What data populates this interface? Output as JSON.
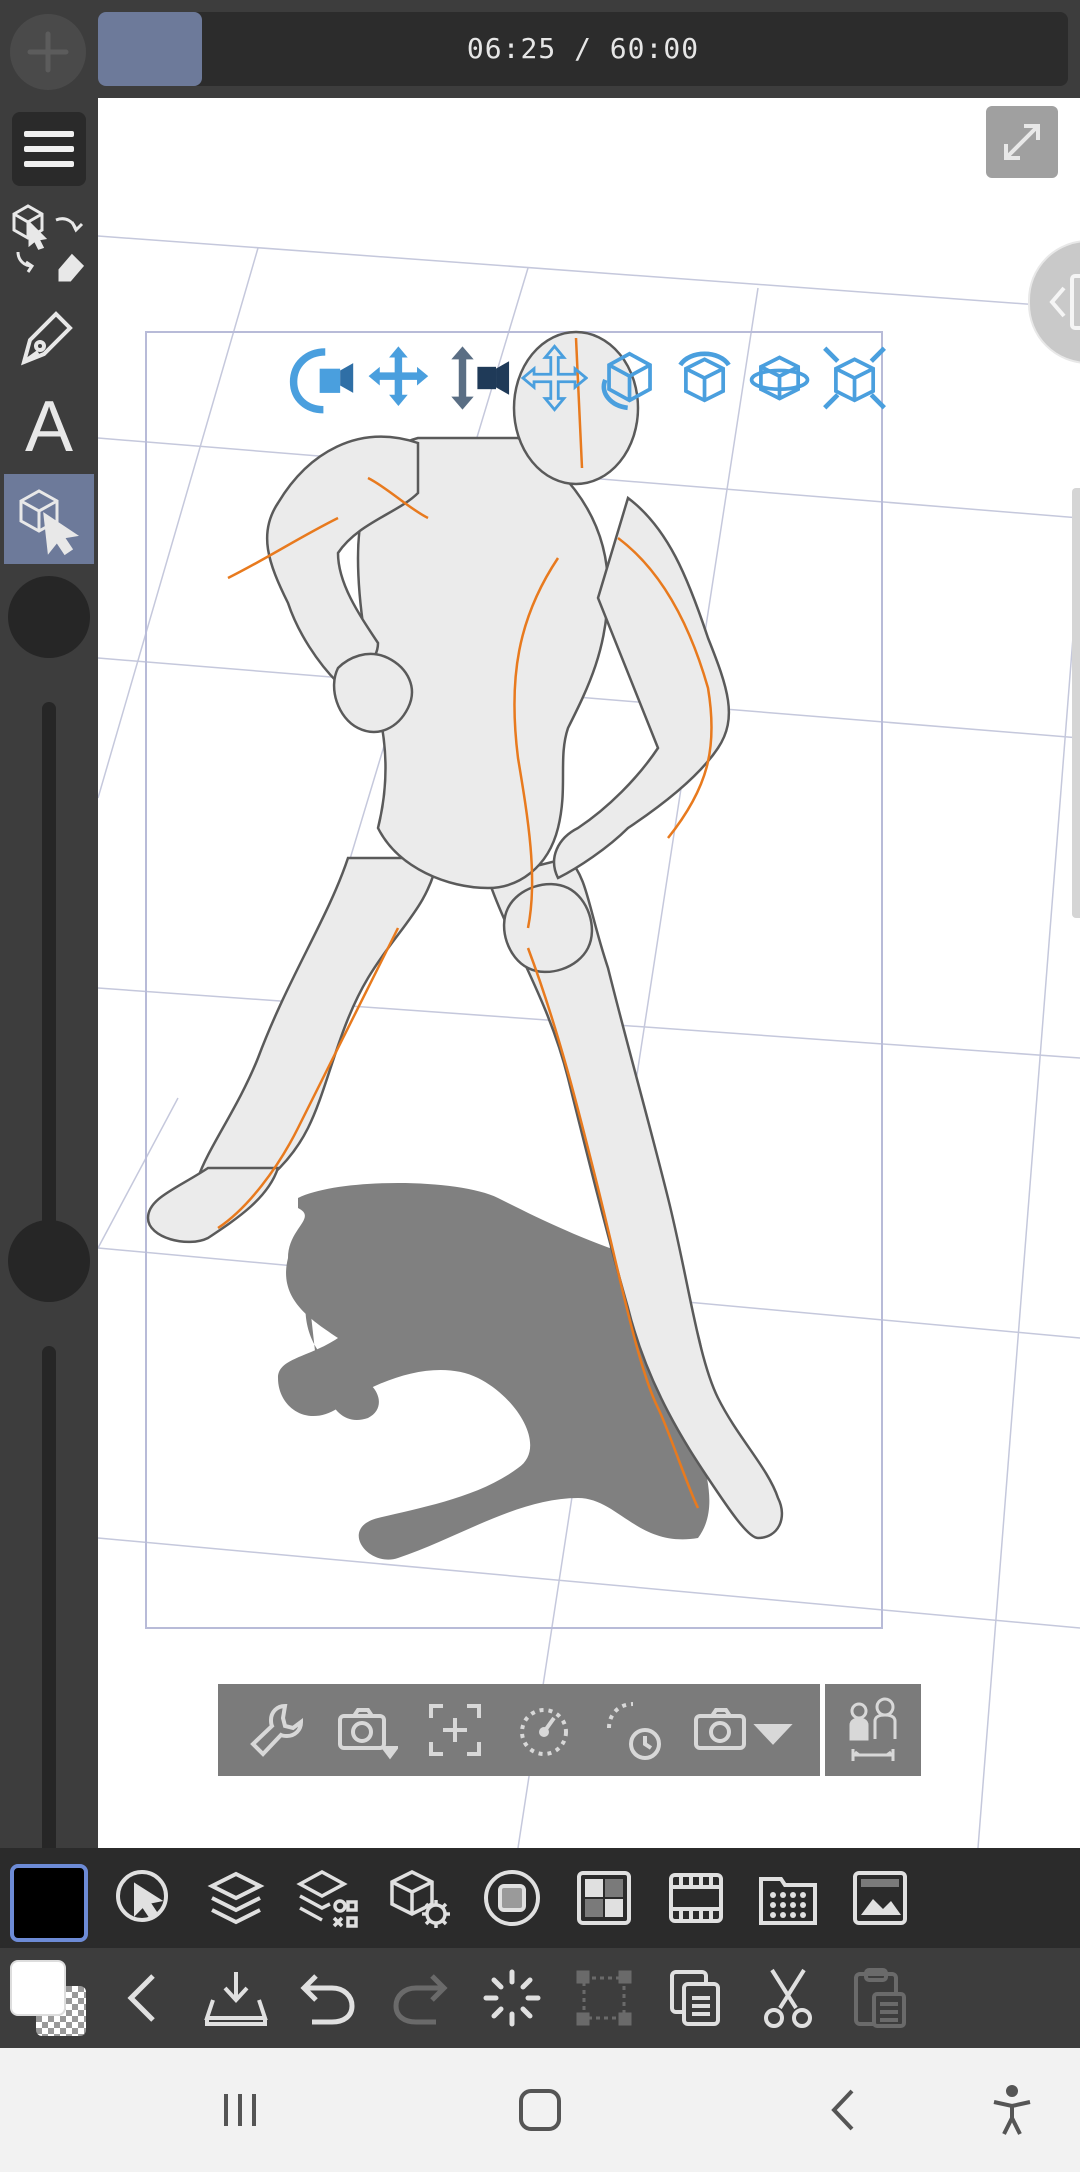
{
  "timer": {
    "text": "06:25 / 60:00"
  },
  "left_toolbar": {
    "tools": [
      "menu-icon",
      "operation-tool-icon",
      "pen-icon",
      "text-tool-icon",
      "3d-object-select-icon"
    ],
    "text_tool_glyph": "A",
    "active_tool": "3d-object-select-icon"
  },
  "canvas": {
    "manipulator_icons": [
      "camera-rotate-icon",
      "camera-pan-icon",
      "camera-dolly-icon",
      "move-icon",
      "rotate-icon",
      "rotate-x-icon",
      "rotate-y-icon",
      "move-on-plane-icon"
    ],
    "object_toolbar": [
      "object-settings-icon",
      "camera-angle-icon",
      "fit-to-center-icon",
      "reset-rotation-icon",
      "reset-pose-icon",
      "camera-preset-icon"
    ],
    "character_toolbar": "pose-figure-icon"
  },
  "bottom_toolbar_1": [
    "selection-icon",
    "layers-icon",
    "layer-property-icon",
    "3d-settings-icon",
    "stop-icon",
    "material-icon",
    "timeline-icon",
    "animation-cels-icon",
    "image-material-icon"
  ],
  "bottom_toolbar_2": [
    "back-icon",
    "save-icon",
    "undo-icon",
    "redo-icon",
    "loading-icon",
    "transform-icon",
    "copy-icon",
    "cut-icon",
    "paste-icon"
  ],
  "colors": {
    "main_color": "#000000",
    "sub_color": "#ffffff",
    "accent": "#6d7a9a",
    "gizmo_blue": "#4a9fde",
    "guide_orange": "#e87a1e"
  },
  "android_nav": [
    "recents-icon",
    "home-icon",
    "back-nav-icon",
    "accessibility-icon"
  ]
}
